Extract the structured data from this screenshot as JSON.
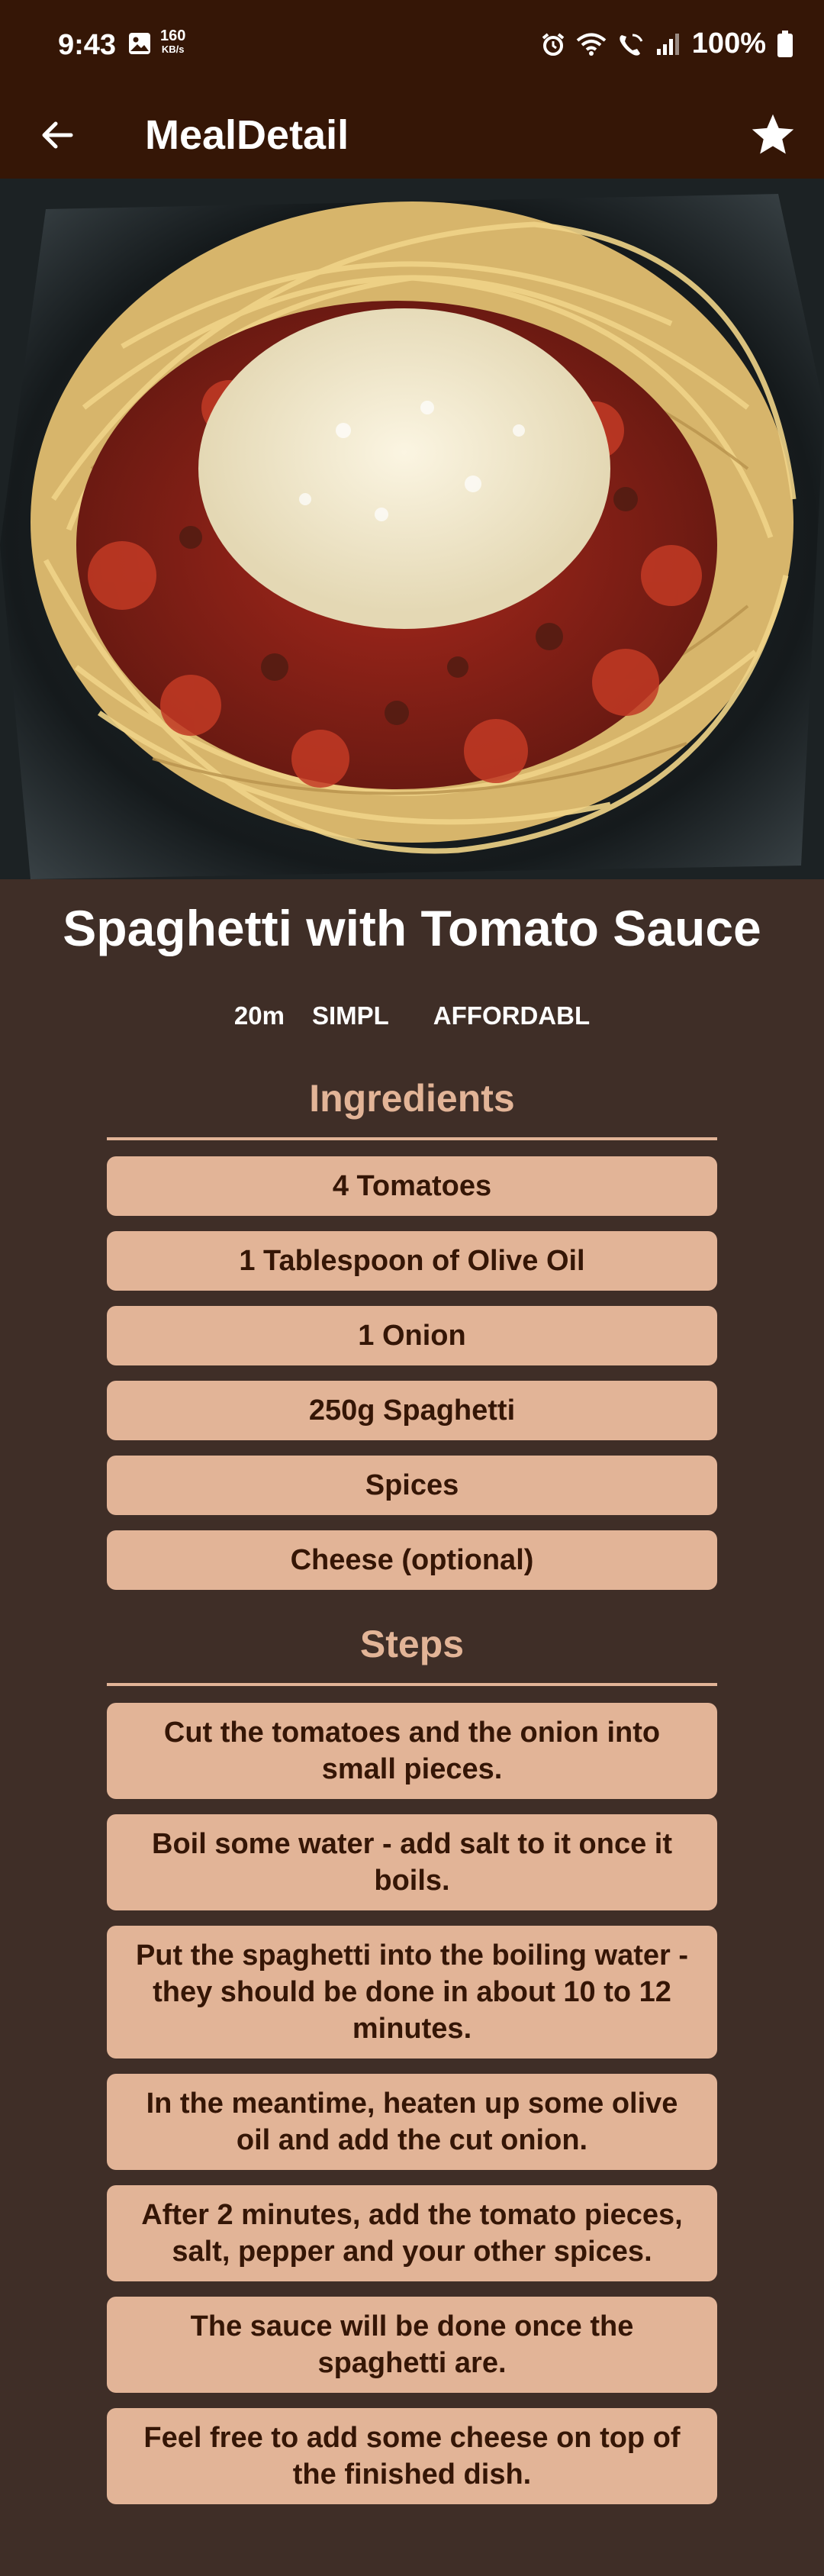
{
  "status": {
    "time": "9:43",
    "speed_value": "160",
    "speed_unit": "KB/s",
    "battery": "100%"
  },
  "app_bar": {
    "title": "MealDetail"
  },
  "meal": {
    "title": "Spaghetti with Tomato Sauce",
    "duration": "20m",
    "complexity": "SIMPL",
    "affordability": "AFFORDABL"
  },
  "ingredients": {
    "title": "Ingredients",
    "items": [
      "4 Tomatoes",
      "1 Tablespoon of Olive Oil",
      "1 Onion",
      "250g Spaghetti",
      "Spices",
      "Cheese (optional)"
    ]
  },
  "steps": {
    "title": "Steps",
    "items": [
      "Cut the tomatoes and the onion into small pieces.",
      "Boil some water - add salt to it once it boils.",
      "Put the spaghetti into the boiling water - they should be done in about 10 to 12 minutes.",
      "In the meantime, heaten up some olive oil and add the cut onion.",
      "After 2 minutes, add the tomato pieces, salt, pepper and your other spices.",
      "The sauce will be done once the spaghetti are.",
      "Feel free to add some cheese on top of the finished dish."
    ]
  },
  "colors": {
    "app_bar": "#351606",
    "background": "#3f2e27",
    "accent": "#e2b497"
  }
}
